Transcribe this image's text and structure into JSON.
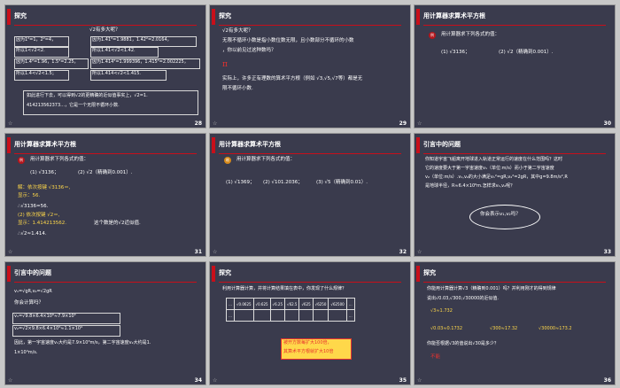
{
  "slides": [
    {
      "num": "28",
      "title": "探究",
      "question": "√2有多大呢？",
      "lines": [
        "因为1²=1，2²=4，",
        "所以1<√2<2.",
        "因为1.4²=1.96，1.5²=2.25，",
        "所以1.4<√2<1.5；",
        "因为1.41²=1.9881，1.42²=2.0164，",
        "所以1.41<√2<1.42.",
        "因为1.414²=1.999396，1.415²=2.002225，",
        "所以1.414<√2<1.415."
      ],
      "para": [
        "如此进行下去，可以得到√2的更精确的近似值事实上，√2=1.",
        "414213562373…，它是一个无限不循环小数."
      ]
    },
    {
      "num": "29",
      "title": "探究",
      "para": [
        "√2有多大呢？",
        "无限不循环小数是指小数位数无限，且小数部分不循环的小数",
        "，你以前见过这种数吗？",
        "π",
        "实际上，许多正有理数的算术平方根（例如 √3,√5,√7等）都是无",
        "限不循环小数."
      ]
    },
    {
      "num": "30",
      "title": "用计算器求算术平方根",
      "badge": "例",
      "task": "用计算器求下列各式的值：",
      "items": [
        "(1) √3136；",
        "(2) √2（精确到0.001）."
      ]
    },
    {
      "num": "31",
      "title": "用计算器求算术平方根",
      "badge": "例",
      "task": "用计算器求下列各式的值：",
      "items": [
        "(1) √3136；",
        "(2) √2（精确到0.001）."
      ],
      "solution": [
        "解：依次按键 √3136＝,",
        "显示：56.",
        "∴√3136=56.",
        "(2) 依次按键 √2＝,",
        "显示：1.414213562.",
        "∴√2≈1.414."
      ],
      "note": "这个数是的√2近似值."
    },
    {
      "num": "32",
      "title": "用计算器求算术平方根",
      "badge": "练",
      "task": "用计算器求下列各式的值：",
      "items": [
        "(1) √1369；",
        "(2) √101.2036；",
        "(3) √5（精确到0.01）."
      ]
    },
    {
      "num": "33",
      "title": "引言中的问题",
      "para": [
        "你知道宇宙飞船离开地球进入轨道正常运行的速度在什么范围吗？这时",
        "它的速度要大于第一宇宙速度v₁（单位:m/s）而小于第二宇宙速度",
        "v₂（单位:m/s）.v₁,v₂的大小满足v₁²=gR,v₂²=2gR，其中g=9.8m/s²,R",
        "是地球半径，R≈6.4×10⁶m.怎样求v₁,v₂呢？"
      ],
      "bubble": "你会表示v₁,v₂吗？"
    },
    {
      "num": "34",
      "title": "引言中的问题",
      "para": [
        "v₁=√gR,v₂=√2gR",
        "你会计算吗？",
        "v₁=√9.8×6.4×10⁶≈7.9×10³",
        "v₂=√2×9.8×6.4×10⁶≈1.1×10⁴",
        "因此，第一宇宙速度v₁大约是7.9×10³m/s，第二宇宙速度v₂大约是1.",
        "1×10⁴m/s."
      ]
    },
    {
      "num": "35",
      "title": "探究",
      "task": "利用计算器计算，并将计算结果填在表中，你发现了什么规律？",
      "table_row1": [
        "…",
        "√0.0625",
        "√0.625",
        "√6.25",
        "√62.5",
        "√625",
        "√6250",
        "√62500",
        "…"
      ],
      "table_row2": [
        "…",
        "",
        "",
        "",
        "",
        "",
        "",
        "",
        "…"
      ],
      "box_lines": [
        "被开方数每扩大100倍，",
        "其算术平方根就扩大10倍"
      ]
    },
    {
      "num": "36",
      "title": "探究",
      "para": [
        "你能用计算器计算√3（精确到0.001）吗？并利用刚才的得到规律",
        "说出√0.03,√300,√30000的近似值."
      ],
      "ans": [
        "√3≈1.732",
        "√0.03≈0.1732",
        "√300≈17.32",
        "√30000≈173.2"
      ],
      "q2": "你能否根据√3的值说出√30是多少？",
      "no": "不能"
    }
  ]
}
